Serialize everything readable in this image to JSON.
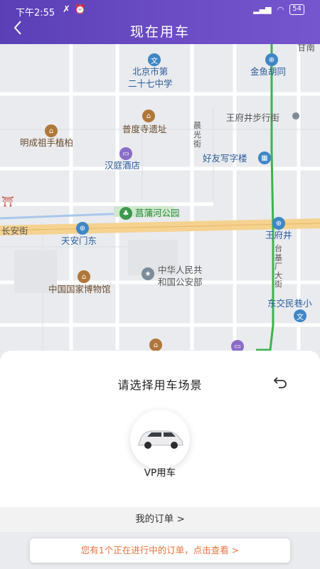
{
  "status_bar": {
    "time": "下午2:55",
    "battery": "54"
  },
  "header": {
    "title": "现在用车",
    "back_icon": "chevron-left-icon"
  },
  "map": {
    "labels": {
      "gan": "甘南",
      "school": "北京市第\n二十七中学",
      "jinyu": "金鱼胡同",
      "wangfujing_st": "王府井步行街",
      "puduo": "普度寺遗址",
      "mingcheng": "明成祖手植柏",
      "chenguang": "晨\n光\n街",
      "youyou": "好友写字楼",
      "hanting": "汉庭酒店",
      "changpu": "菖蒲河公园",
      "changan": "长安街",
      "tiananmen": "天安门东",
      "wangfujing": "王府井",
      "taijichang": "台\n基\n厂\n大\n街",
      "gonganbu": "中华人民共\n和国公安部",
      "museum": "中国国家博物馆",
      "dongjiao": "东交民巷小"
    }
  },
  "sheet": {
    "title": "请选择用车场景",
    "car_label": "VP用车",
    "orders_label": "我的订单  >",
    "notice": "您有1个正在进行中的订单，点击查看  >"
  },
  "colors": {
    "header": "#6a4bc4",
    "notice_text": "#e8723c"
  }
}
